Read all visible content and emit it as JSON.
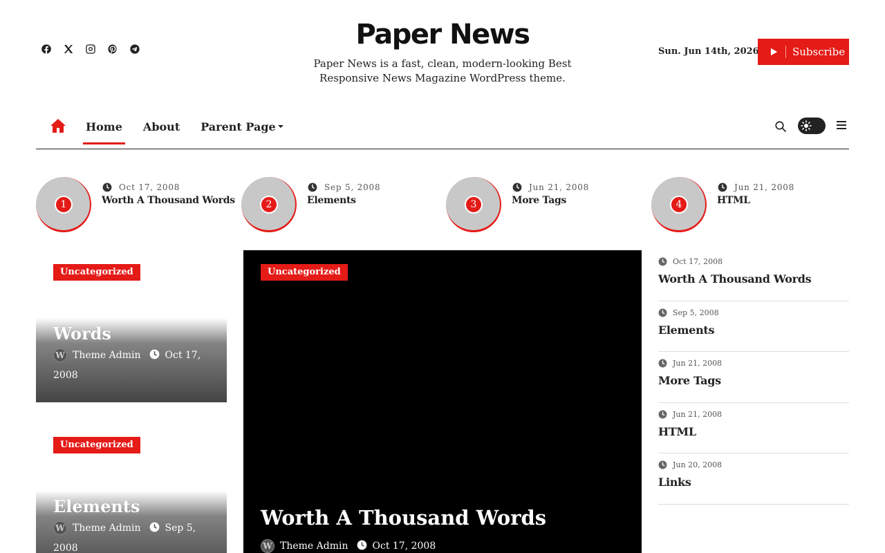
{
  "header": {
    "site_title": "Paper News",
    "site_description_line1": "Paper News is a fast, clean, modern-looking Best",
    "site_description_line2": "Responsive News Magazine WordPress theme.",
    "date": "Sun. Jun 14th, 2026",
    "subscribe_label": "Subscribe",
    "socials": [
      "facebook-icon",
      "x-twitter-icon",
      "instagram-icon",
      "pinterest-icon",
      "telegram-icon"
    ]
  },
  "nav": {
    "items": [
      {
        "label": "Home"
      },
      {
        "label": "About"
      },
      {
        "label": "Parent Page"
      }
    ]
  },
  "trending": [
    {
      "num": "1",
      "date": "Oct 17, 2008",
      "title": "Worth A Thousand Words"
    },
    {
      "num": "2",
      "date": "Sep 5, 2008",
      "title": "Elements"
    },
    {
      "num": "3",
      "date": "Jun 21, 2008",
      "title": "More Tags"
    },
    {
      "num": "4",
      "date": "Jun 21, 2008",
      "title": "HTML"
    }
  ],
  "cards": [
    {
      "category": "Uncategorized",
      "title": "Words",
      "author": "Theme Admin",
      "date_line1": "Oct 17,",
      "date_line2": "2008"
    },
    {
      "category": "Uncategorized",
      "title": "Elements",
      "author": "Theme Admin",
      "date_line1": "Sep 5,",
      "date_line2": "2008"
    }
  ],
  "hero": {
    "category": "Uncategorized",
    "title": "Worth A Thousand Words",
    "author": "Theme Admin",
    "date": "Oct 17, 2008"
  },
  "list": [
    {
      "date": "Oct 17, 2008",
      "title": "Worth A Thousand Words"
    },
    {
      "date": "Sep 5, 2008",
      "title": "Elements"
    },
    {
      "date": "Jun 21, 2008",
      "title": "More Tags"
    },
    {
      "date": "Jun 21, 2008",
      "title": "HTML"
    },
    {
      "date": "Jun 20, 2008",
      "title": "Links"
    }
  ],
  "colors": {
    "accent": "#e41b17",
    "text": "#222222",
    "hero_bg": "#000000"
  }
}
